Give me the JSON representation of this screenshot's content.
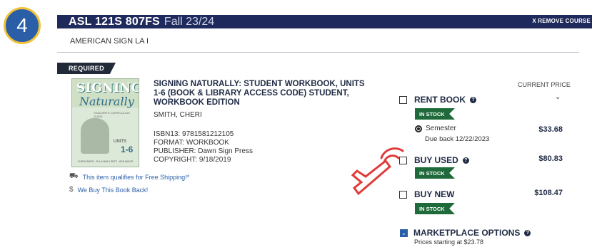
{
  "step": {
    "number": "4"
  },
  "course": {
    "code": "ASL 121S 807FS",
    "term": "Fall 23/24",
    "remove_label": "X REMOVE COURSE",
    "name": "AMERICAN SIGN LA I"
  },
  "requirement": {
    "label": "REQUIRED"
  },
  "book": {
    "cover": {
      "title_line1": "SIGNING",
      "title_line2": "Naturally",
      "subtitle": "TEACHER'S CURRICULUM GUIDE",
      "units_label": "UNITS",
      "units_number": "1-6",
      "authors": "CHERI SMITH · ELLA MAE LENTZ · KEN MIKOS"
    },
    "title": "SIGNING NATURALLY: STUDENT WORKBOOK, UNITS 1-6 (BOOK & LIBRARY ACCESS CODE) STUDENT, WORKBOOK EDITION",
    "author": "SMITH, CHERI",
    "isbn": "ISBN13: 9781581212105",
    "format": "FORMAT: WORKBOOK",
    "publisher": "PUBLISHER: Dawn Sign Press",
    "copyright": "COPYRIGHT: 9/18/2019"
  },
  "perks": {
    "shipping": "This item qualifies for Free Shipping!*",
    "buyback": "We Buy This Book Back!"
  },
  "pricing": {
    "header": "CURRENT PRICE",
    "rent": {
      "label": "RENT BOOK",
      "stock": "IN STOCK",
      "term": "Semester",
      "due": "Due back 12/22/2023",
      "price": "$33.68"
    },
    "used": {
      "label": "BUY USED",
      "stock": "IN STOCK",
      "price": "$80.83"
    },
    "new": {
      "label": "BUY NEW",
      "stock": "IN STOCK",
      "price": "$108.47"
    },
    "marketplace": {
      "label": "MARKETPLACE OPTIONS",
      "sub": "Prices starting at $23.78"
    }
  },
  "icons": {
    "info": "info-icon",
    "truck": "truck-icon",
    "dollar": "dollar-icon",
    "chevron": "chevron-down-icon",
    "marketplace": "marketplace-icon",
    "pointer": "pointer-hand-icon"
  },
  "colors": {
    "course_bar": "#1f2a5c",
    "in_stock": "#1f6a3a",
    "badge_fill": "#2a5fa8",
    "badge_ring": "#f2c33a",
    "pointer": "#e03a3a"
  }
}
